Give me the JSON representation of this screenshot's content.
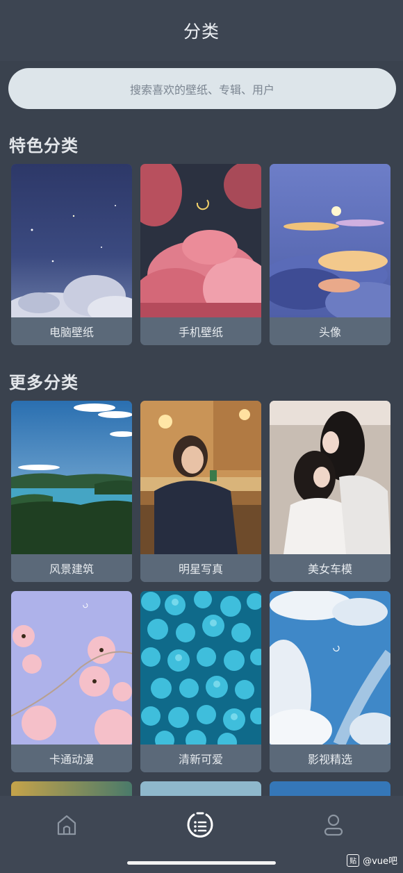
{
  "header": {
    "title": "分类"
  },
  "search": {
    "placeholder": "搜索喜欢的壁纸、专辑、用户"
  },
  "featured": {
    "title": "特色分类",
    "items": [
      {
        "label": "电脑壁纸"
      },
      {
        "label": "手机壁纸"
      },
      {
        "label": "头像"
      }
    ]
  },
  "more": {
    "title": "更多分类",
    "items": [
      {
        "label": "风景建筑"
      },
      {
        "label": "明星写真"
      },
      {
        "label": "美女车模"
      },
      {
        "label": "卡通动漫"
      },
      {
        "label": "清新可爱"
      },
      {
        "label": "影视精选"
      }
    ]
  },
  "tabbar": {
    "items": [
      {
        "icon": "home-icon",
        "active": false
      },
      {
        "icon": "category-icon",
        "active": true
      },
      {
        "icon": "user-icon",
        "active": false
      }
    ]
  },
  "watermark": {
    "badge": "贴",
    "text": "@vue吧"
  },
  "colors": {
    "background": "#3a424e",
    "card_label_bg": "#5b6979",
    "search_bg": "#dde5ea"
  }
}
